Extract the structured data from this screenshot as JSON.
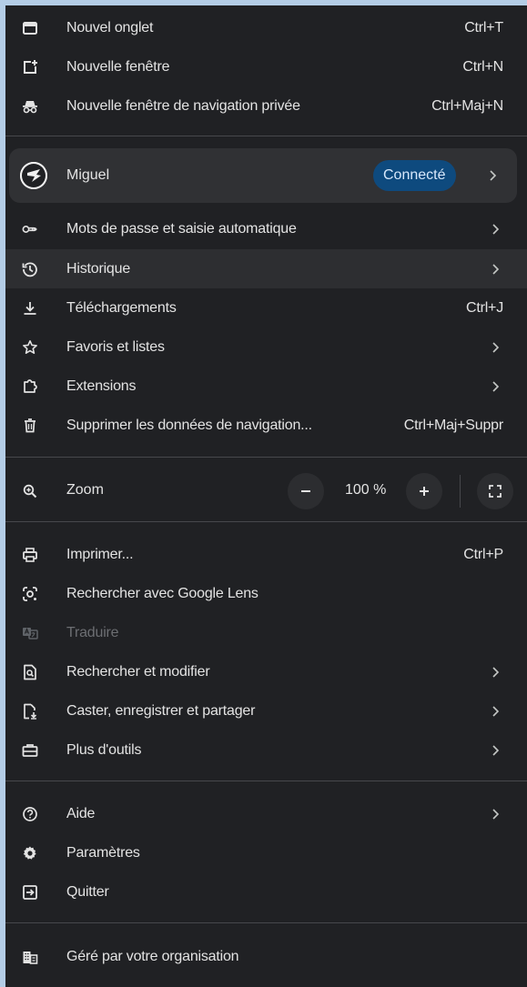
{
  "menu": {
    "new_tab": {
      "label": "Nouvel onglet",
      "shortcut": "Ctrl+T"
    },
    "new_window": {
      "label": "Nouvelle fenêtre",
      "shortcut": "Ctrl+N"
    },
    "incognito": {
      "label": "Nouvelle fenêtre de navigation privée",
      "shortcut": "Ctrl+Maj+N"
    },
    "profile": {
      "name": "Miguel",
      "status": "Connecté"
    },
    "passwords": {
      "label": "Mots de passe et saisie automatique"
    },
    "history": {
      "label": "Historique"
    },
    "downloads": {
      "label": "Téléchargements",
      "shortcut": "Ctrl+J"
    },
    "bookmarks": {
      "label": "Favoris et listes"
    },
    "extensions": {
      "label": "Extensions"
    },
    "clear_data": {
      "label": "Supprimer les données de navigation...",
      "shortcut": "Ctrl+Maj+Suppr"
    },
    "zoom": {
      "label": "Zoom",
      "value": "100 %",
      "minus": "–",
      "plus": "+"
    },
    "print": {
      "label": "Imprimer...",
      "shortcut": "Ctrl+P"
    },
    "lens": {
      "label": "Rechercher avec Google Lens"
    },
    "translate": {
      "label": "Traduire"
    },
    "find": {
      "label": "Rechercher et modifier"
    },
    "cast": {
      "label": "Caster, enregistrer et partager"
    },
    "more_tools": {
      "label": "Plus d'outils"
    },
    "help": {
      "label": "Aide"
    },
    "settings": {
      "label": "Paramètres"
    },
    "quit": {
      "label": "Quitter"
    },
    "managed": {
      "label": "Géré par votre organisation"
    }
  },
  "colors": {
    "background": "#202124",
    "hover": "#2d2e31",
    "badge": "#0e4a7e",
    "page": "#b4cde6"
  }
}
